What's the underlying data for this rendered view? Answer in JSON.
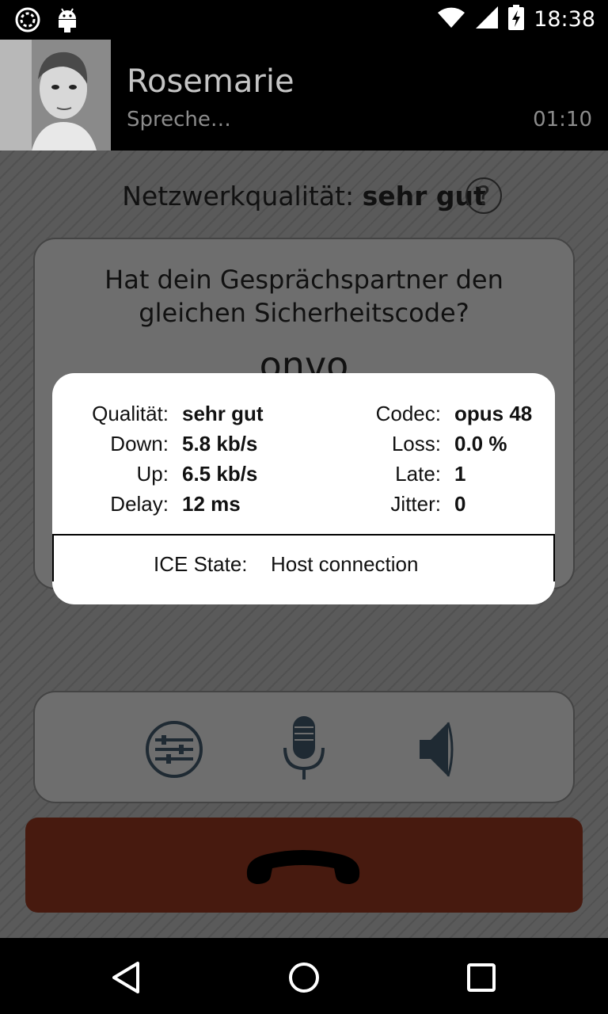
{
  "status_bar": {
    "time": "18:38",
    "icons": [
      "sync-circle-icon",
      "android-debug-icon",
      "wifi-icon",
      "cell-signal-icon",
      "battery-charging-icon"
    ]
  },
  "call": {
    "caller_name": "Rosemarie",
    "status": "Spreche…",
    "timer": "01:10"
  },
  "network": {
    "label": "Netzwerkqualität:",
    "value": "sehr gut",
    "help_symbol": "?"
  },
  "sas": {
    "question": "Hat dein Gesprächspartner den gleichen Sicherheitscode?",
    "code": "onvo"
  },
  "controls": {
    "icons": [
      "settings-sliders-icon",
      "microphone-icon",
      "speaker-icon"
    ],
    "hangup_icon": "phone-hangup-icon"
  },
  "stats_popup": {
    "left": [
      {
        "label": "Qualität:",
        "value": "sehr gut"
      },
      {
        "label": "Down:",
        "value": "5.8 kb/s"
      },
      {
        "label": "Up:",
        "value": "6.5 kb/s"
      },
      {
        "label": "Delay:",
        "value": "12 ms"
      }
    ],
    "right": [
      {
        "label": "Codec:",
        "value": "opus 48"
      },
      {
        "label": "Loss:",
        "value": "0.0 %"
      },
      {
        "label": "Late:",
        "value": "1"
      },
      {
        "label": "Jitter:",
        "value": "0"
      }
    ],
    "ice_label": "ICE State:",
    "ice_value": "Host connection"
  },
  "colors": {
    "hangup": "#471a0f",
    "background": "#5a5a5a",
    "control_icon": "#1f2a33"
  }
}
